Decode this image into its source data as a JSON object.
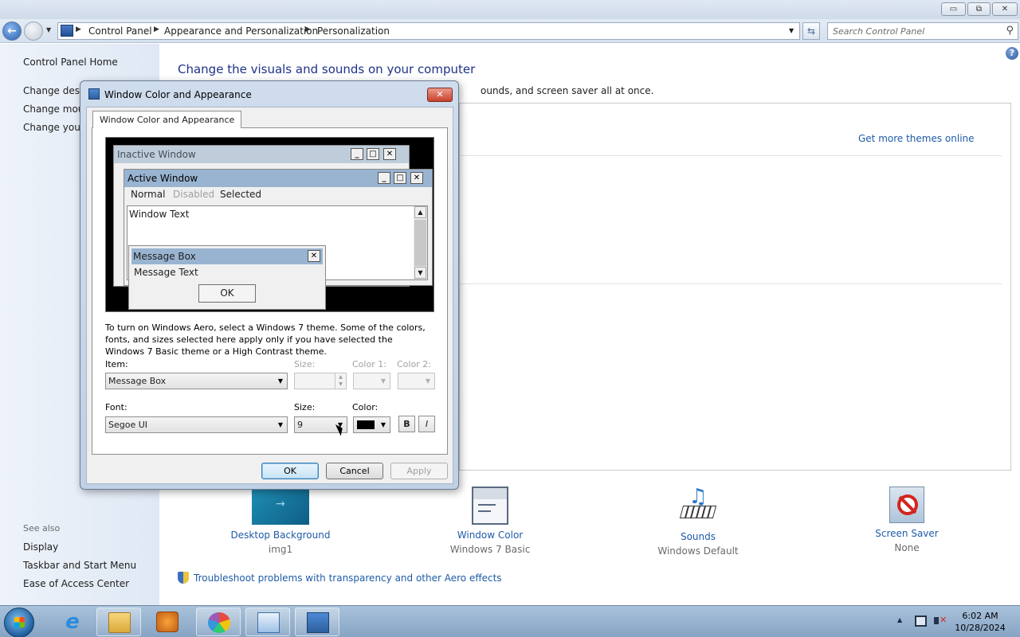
{
  "window": {
    "caption_buttons": {
      "minimize": "▭",
      "restore": "⧉",
      "close": "✕"
    }
  },
  "address": {
    "breadcrumbs": [
      "Control Panel",
      "Appearance and Personalization",
      "Personalization"
    ],
    "search_placeholder": "Search Control Panel"
  },
  "sidebar": {
    "home": "Control Panel Home",
    "links": [
      "Change deskt",
      "Change mous",
      "Change your"
    ],
    "see_also_label": "See also",
    "see_also": [
      "Display",
      "Taskbar and Start Menu",
      "Ease of Access Center"
    ]
  },
  "main": {
    "title": "Change the visuals and sounds on your computer",
    "subtitle": "ounds, and screen saver all at once.",
    "more_themes": "Get more themes online",
    "help_icon": "?",
    "tiles": [
      {
        "label": "Desktop Background",
        "value": "img1",
        "icon": "desktop-background-icon"
      },
      {
        "label": "Window Color",
        "value": "Windows 7 Basic",
        "icon": "window-color-icon"
      },
      {
        "label": "Sounds",
        "value": "Windows Default",
        "icon": "sounds-icon"
      },
      {
        "label": "Screen Saver",
        "value": "None",
        "icon": "screen-saver-icon"
      }
    ],
    "troubleshoot": "Troubleshoot problems with transparency and other Aero effects"
  },
  "dialog": {
    "title": "Window Color and Appearance",
    "close": "✕",
    "tab": "Window Color and Appearance",
    "preview": {
      "inactive_title": "Inactive Window",
      "active_title": "Active Window",
      "menu": [
        "Normal",
        "Disabled",
        "Selected"
      ],
      "window_text": "Window Text",
      "msgbox_title": "Message Box",
      "msgbox_text": "Message Text",
      "msgbox_ok": "OK",
      "btn_min": "_",
      "btn_max": "□",
      "btn_close": "✕"
    },
    "info": "To turn on Windows Aero, select a Windows 7 theme.  Some of the colors, fonts, and sizes selected here apply only if you have selected the Windows 7 Basic theme or a High Contrast theme.",
    "item_label": "Item:",
    "item_value": "Message Box",
    "size_label": "Size:",
    "color1_label": "Color 1:",
    "color2_label": "Color 2:",
    "font_label": "Font:",
    "font_value": "Segoe UI",
    "font_size_label": "Size:",
    "font_size_value": "9",
    "font_color_label": "Color:",
    "font_color": "#000000",
    "bold": "B",
    "italic": "I",
    "ok": "OK",
    "cancel": "Cancel",
    "apply": "Apply"
  },
  "taskbar": {
    "items": [
      "internet-explorer-icon",
      "windows-explorer-icon",
      "media-player-icon",
      "paint-icon",
      "control-panel-icon",
      "window-color-icon"
    ],
    "time": "6:02 AM",
    "date": "10/28/2024",
    "tray_arrow": "▲"
  },
  "colors": {
    "link": "#1e5ba7",
    "title_blue": "#1e3287",
    "inactive_title_bg": "#bfcddb",
    "active_title_bg": "#99b4d1",
    "selected_bg": "#99b4d1"
  }
}
